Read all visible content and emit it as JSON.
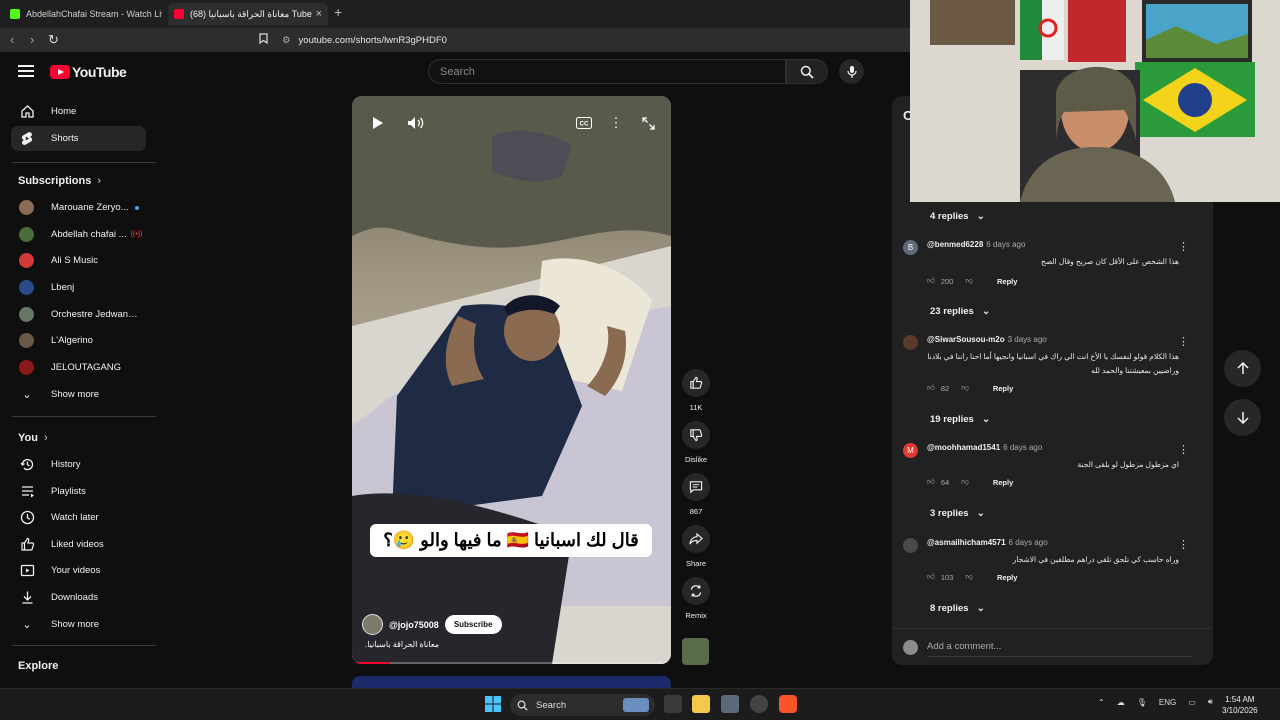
{
  "browser": {
    "tabs": [
      {
        "title": "AbdellahChafai Stream - Watch Live",
        "favicon_color": "#53fc18",
        "active": false
      },
      {
        "title": "(68) معاناة الحراقة باسبانيا Tube",
        "favicon_color": "#ff0033",
        "active": true
      }
    ],
    "url": "youtube.com/shorts/lwnR3gPHDF0"
  },
  "header": {
    "logo_text": "YouTube",
    "search_placeholder": "Search"
  },
  "sidebar": {
    "main": [
      {
        "label": "Home",
        "icon": "home-icon",
        "active": false
      },
      {
        "label": "Shorts",
        "icon": "shorts-icon",
        "active": true
      }
    ],
    "subscriptions_heading": "Subscriptions",
    "subscriptions": [
      {
        "label": "Marouane Zeryo...",
        "color": "#8a6b55",
        "indicator": "dot"
      },
      {
        "label": "Abdellah chafai ...",
        "color": "#4a6b3a",
        "indicator": "live"
      },
      {
        "label": "Ali S Music",
        "color": "#d23a3a",
        "indicator": ""
      },
      {
        "label": "Lbenj",
        "color": "#2a4a8a",
        "indicator": ""
      },
      {
        "label": "Orchestre Jedwane...",
        "color": "#667766",
        "indicator": ""
      },
      {
        "label": "L'Algerino",
        "color": "#6b5a4a",
        "indicator": ""
      },
      {
        "label": "JELOUTAGANG",
        "color": "#8a1a1a",
        "indicator": ""
      }
    ],
    "show_more_1": "Show more",
    "you_heading": "You",
    "you_items": [
      {
        "label": "History",
        "icon": "history-icon"
      },
      {
        "label": "Playlists",
        "icon": "playlists-icon"
      },
      {
        "label": "Watch later",
        "icon": "watch-later-icon"
      },
      {
        "label": "Liked videos",
        "icon": "liked-videos-icon"
      },
      {
        "label": "Your videos",
        "icon": "your-videos-icon"
      },
      {
        "label": "Downloads",
        "icon": "downloads-icon"
      }
    ],
    "show_more_2": "Show more",
    "explore_heading": "Explore"
  },
  "short": {
    "caption": "قال لك اسبانيا 🇪🇸 ما فيها والو 🥲؟",
    "channel_handle": "@jojo75008",
    "subscribe_label": "Subscribe",
    "title": "معاناة الحراقة باسبانيا.",
    "progress_fraction": 0.12
  },
  "actions": {
    "likes": "11K",
    "dislike": "Dislike",
    "comments_count": "867",
    "share": "Share",
    "remix": "Remix"
  },
  "comments": {
    "title": "C",
    "replies_top": "4 replies",
    "items": [
      {
        "author": "@benmed6228",
        "date": "6 days ago",
        "avatar_letter": "B",
        "avatar_color": "#5f6b7a",
        "text": "هذا الشخص على الأقل كان صريح وقال الصح",
        "likes": "200",
        "reply": "Reply",
        "replies": "23 replies"
      },
      {
        "author": "@SiwarSousou-m2o",
        "date": "3 days ago",
        "avatar_letter": "",
        "avatar_color": "#5a3a2a",
        "text": "هذا الكلام قولو لنفسك يا الأخ انت الي راك في اسبانيا وانجيها أما احنا راننا في بلادنا وراضيين بمعيشتنا والحمد لله",
        "likes": "82",
        "reply": "Reply",
        "replies": "19 replies"
      },
      {
        "author": "@moohhamad1541",
        "date": "6 days ago",
        "avatar_letter": "M",
        "avatar_color": "#e53935",
        "text": "اي مزطول مزطول لو بلقى الجنة",
        "likes": "64",
        "reply": "Reply",
        "replies": "3 replies"
      },
      {
        "author": "@asmailhicham4571",
        "date": "6 days ago",
        "avatar_letter": "",
        "avatar_color": "#4a4a4a",
        "text": "وراه حاسب كي تلحق تلقي دراهم مطلقين في الاشجار",
        "likes": "103",
        "reply": "Reply",
        "replies": "8 replies"
      }
    ],
    "add_placeholder": "Add a comment..."
  },
  "taskbar": {
    "search_label": "Search",
    "lang": "ENG",
    "time": "1:54 AM",
    "date": "3/10/2026"
  }
}
